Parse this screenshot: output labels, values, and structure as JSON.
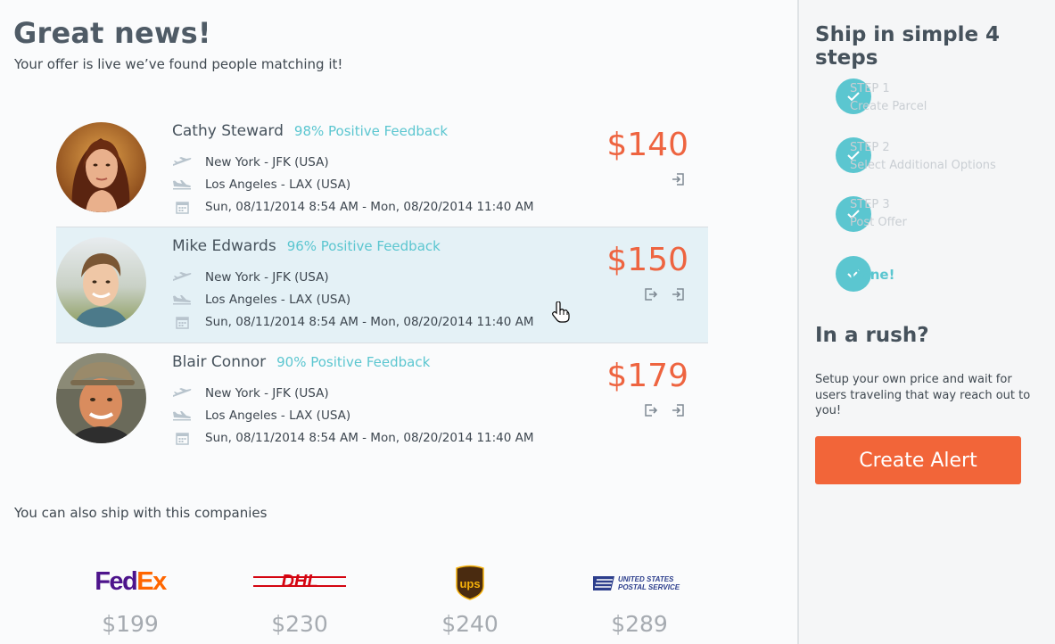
{
  "header": {
    "title": "Great news!",
    "subtitle": "Your offer is live we’ve found people matching it!"
  },
  "offers": [
    {
      "name": "Cathy Steward",
      "feedback": "98% Positive Feedback",
      "from": "New York - JFK (USA)",
      "to": "Los Angeles - LAX (USA)",
      "dates": "Sun, 08/11/2014 8:54 AM - Mon, 08/20/2014 11:40 AM",
      "price": "$140",
      "avatar_icon": "avatar-woman-photo"
    },
    {
      "name": "Mike Edwards",
      "feedback": "96% Positive Feedback",
      "from": "New York - JFK (USA)",
      "to": "Los Angeles - LAX (USA)",
      "dates": "Sun, 08/11/2014 8:54 AM - Mon, 08/20/2014 11:40 AM",
      "price": "$150",
      "avatar_icon": "avatar-man-photo"
    },
    {
      "name": "Blair Connor",
      "feedback": "90% Positive Feedback",
      "from": "New York - JFK (USA)",
      "to": "Los Angeles - LAX (USA)",
      "dates": "Sun, 08/11/2014 8:54 AM - Mon, 08/20/2014 11:40 AM",
      "price": "$179",
      "avatar_icon": "avatar-man-cap-photo"
    }
  ],
  "companies": {
    "title": "You can also ship with this companies",
    "items": [
      {
        "logo": "fedex-logo",
        "logo_text_1": "Fed",
        "logo_text_2": "Ex",
        "price": "$199"
      },
      {
        "logo": "dhl-logo",
        "logo_text": "DHL",
        "price": "$230"
      },
      {
        "logo": "ups-logo",
        "logo_text": "ups",
        "price": "$240"
      },
      {
        "logo": "usps-logo",
        "logo_text_1": "UNITED STATES",
        "logo_text_2": "POSTAL SERVICE",
        "price": "$289"
      }
    ]
  },
  "sidebar": {
    "title": "Ship in simple 4 steps",
    "steps": [
      {
        "number": "STEP 1",
        "label": "Create Parcel"
      },
      {
        "number": "STEP 2",
        "label": "Select Additional Options"
      },
      {
        "number": "STEP 3",
        "label": "Post Offer"
      },
      {
        "label": "Done!"
      }
    ],
    "rush_title": "In a rush?",
    "rush_text": "Setup your own price and wait for users traveling that way reach out to you!",
    "cta_label": "Create Alert"
  },
  "colors": {
    "accent_teal": "#5bc6d0",
    "price_orange": "#ee6440",
    "cta_orange": "#f26539",
    "highlight_row": "#e4f1f6"
  }
}
